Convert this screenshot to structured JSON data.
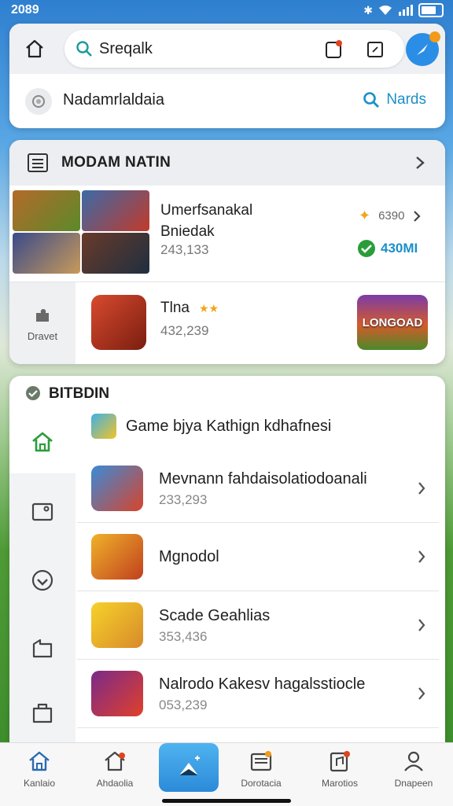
{
  "status": {
    "time": "2089"
  },
  "header": {
    "search_text": "Sreqalk",
    "profile_name": "Nadamrlaldaia",
    "nards_label": "Nards"
  },
  "featured": {
    "title": "MODAM NATIN",
    "item1": {
      "title_line1": "Umerfsanakal",
      "title_line2": "Bniedak",
      "count": "243,133",
      "right_value": "6390",
      "size": "430MI"
    },
    "item2": {
      "side_label": "Dravet",
      "title": "Tlna",
      "count": "432,239",
      "banner_text": "LONGOAD"
    }
  },
  "section": {
    "title": "BITBDIN",
    "game_header": "Game bjya Kathign kdhafnesi",
    "items": [
      {
        "title": "Mevnann fahdaisolatiodoanali",
        "count": "233,293"
      },
      {
        "title": "Mgnodol",
        "count": ""
      },
      {
        "title": "Scade Geahlias",
        "count": "353,436"
      },
      {
        "title": "Nalrodo Kakesv hagalsstiocle",
        "count": "053,239"
      }
    ]
  },
  "bottom_nav": [
    {
      "label": "Kanlaio"
    },
    {
      "label": "Ahdaolia"
    },
    {
      "label": "Dorotacia"
    },
    {
      "label": "Marotios"
    },
    {
      "label": "Dnapeen"
    }
  ],
  "colors": {
    "accent": "#1a8fc9",
    "rail_active": "#2a9d3a",
    "badge": "#f29a1a"
  }
}
